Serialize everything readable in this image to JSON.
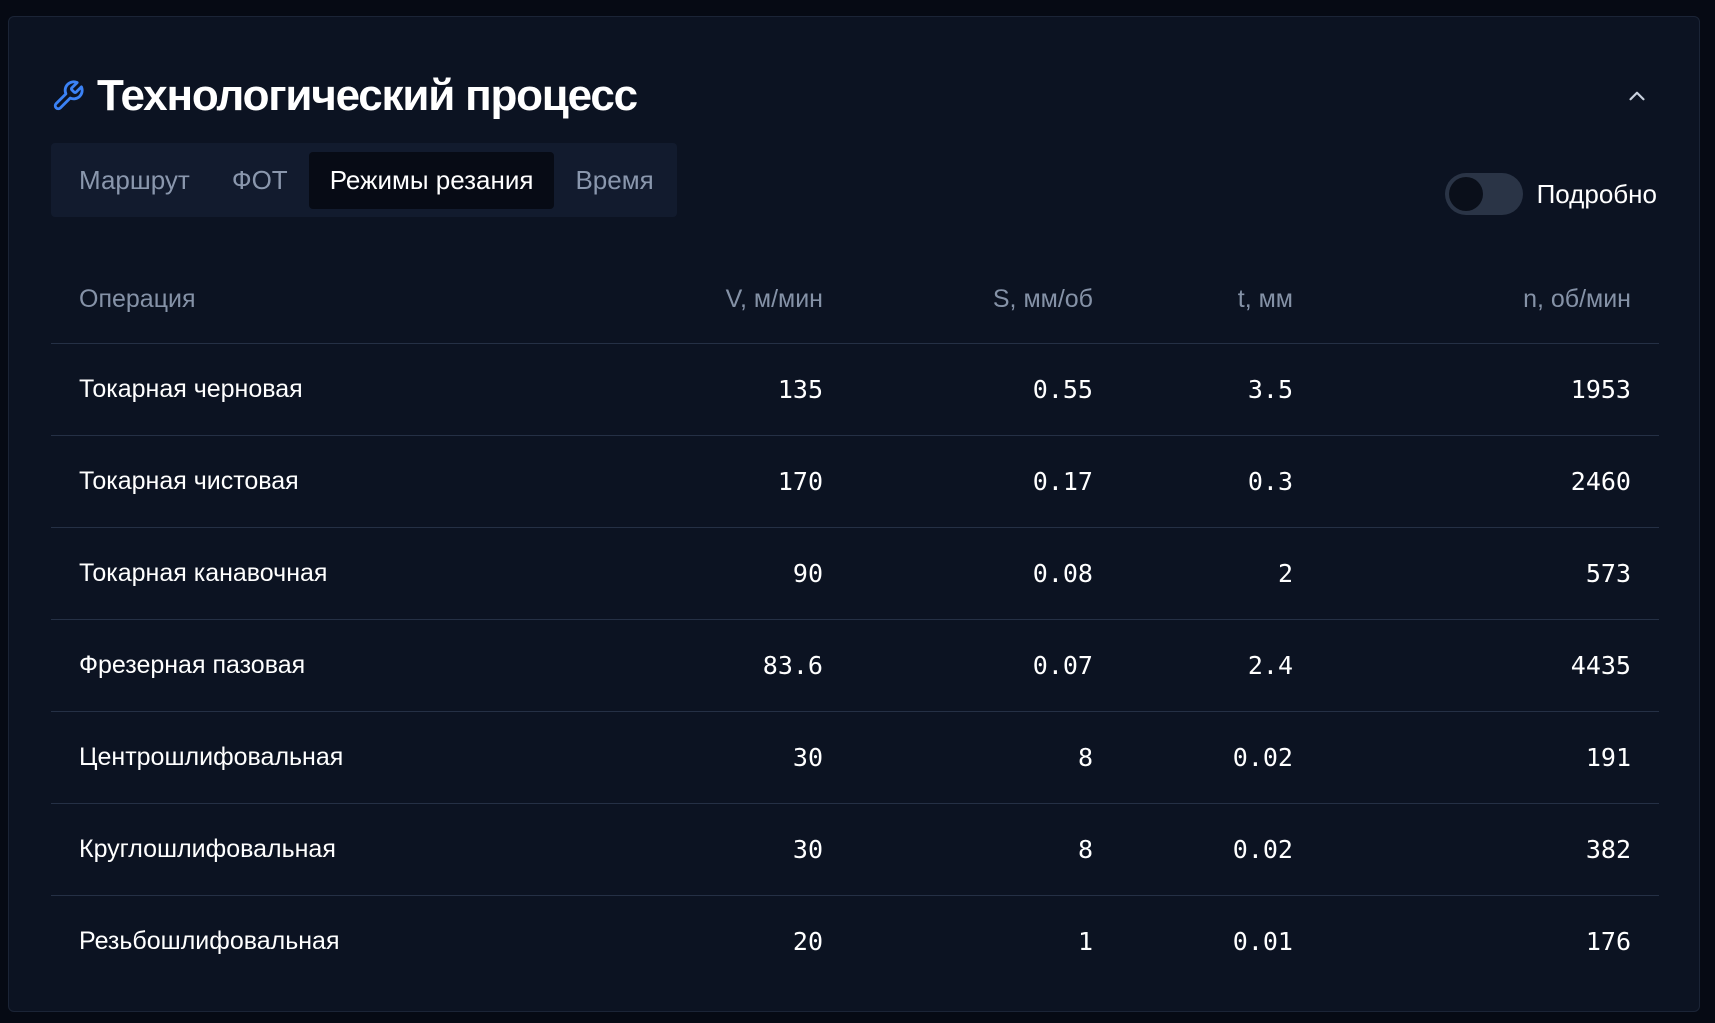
{
  "header": {
    "title": "Технологический процесс",
    "icon": "wrench-icon",
    "collapse_icon": "chevron-up-icon"
  },
  "tabs": [
    {
      "label": "Маршрут",
      "active": false
    },
    {
      "label": "ФОТ",
      "active": false
    },
    {
      "label": "Режимы резания",
      "active": true
    },
    {
      "label": "Время",
      "active": false
    }
  ],
  "toggle": {
    "label": "Подробно",
    "on": false
  },
  "table": {
    "columns": [
      "Операция",
      "V, м/мин",
      "S, мм/об",
      "t, мм",
      "n, об/мин"
    ],
    "rows": [
      [
        "Токарная черновая",
        "135",
        "0.55",
        "3.5",
        "1953"
      ],
      [
        "Токарная чистовая",
        "170",
        "0.17",
        "0.3",
        "2460"
      ],
      [
        "Токарная канавочная",
        "90",
        "0.08",
        "2",
        "573"
      ],
      [
        "Фрезерная пазовая",
        "83.6",
        "0.07",
        "2.4",
        "4435"
      ],
      [
        "Центрошлифовальная",
        "30",
        "8",
        "0.02",
        "191"
      ],
      [
        "Круглошлифовальная",
        "30",
        "8",
        "0.02",
        "382"
      ],
      [
        "Резьбошлифовальная",
        "20",
        "1",
        "0.01",
        "176"
      ]
    ]
  },
  "colors": {
    "accent": "#3b82f6",
    "panel_bg": "#0c1322",
    "page_bg": "#060a14"
  }
}
